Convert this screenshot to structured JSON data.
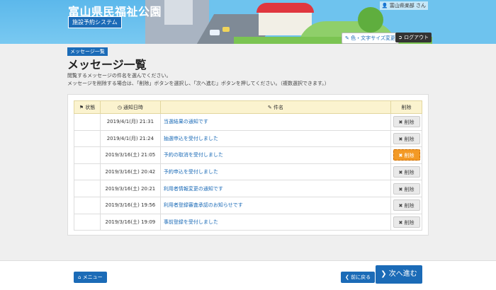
{
  "header": {
    "site_title": "富山県民福祉公園",
    "system_badge": "施設予約システム",
    "user_name": "富山県楽部 さん",
    "color_btn": "色・文字サイズ変更",
    "logout_btn": "ログアウト"
  },
  "breadcrumb": "メッセージ一覧",
  "page_title": "メッセージ一覧",
  "desc_line1": "閲覧するメッセージの件名を選んでください。",
  "desc_line2": "メッセージを削除する場合は、「削除」ボタンを選択し、「次へ進む」ボタンを押してください。（複数選択できます。）",
  "table": {
    "headers": {
      "status": "状態",
      "date": "通知日時",
      "subject": "件名",
      "delete": "削除"
    },
    "rows": [
      {
        "date": "2019/4/1(月) 21:31",
        "subject": "当選結果の通知です",
        "action": "削除"
      },
      {
        "date": "2019/4/1(月) 21:24",
        "subject": "抽選申込を受付しました",
        "action": "削除"
      },
      {
        "date": "2019/3/16(土) 21:05",
        "subject": "予約の取消を受付しました",
        "action": "削除"
      },
      {
        "date": "2019/3/16(土) 20:42",
        "subject": "予約申込を受付しました",
        "action": "削除"
      },
      {
        "date": "2019/3/16(土) 20:21",
        "subject": "利用者情報変更の通知です",
        "action": "削除"
      },
      {
        "date": "2019/3/16(土) 19:56",
        "subject": "利用者登録審査承認のお知らせです",
        "action": "削除"
      },
      {
        "date": "2019/3/16(土) 19:09",
        "subject": "事前登録を受付しました",
        "action": "削除"
      }
    ]
  },
  "footer": {
    "menu_btn": "メニュー",
    "back_btn": "前に戻る",
    "next_btn": "次へ進む"
  }
}
